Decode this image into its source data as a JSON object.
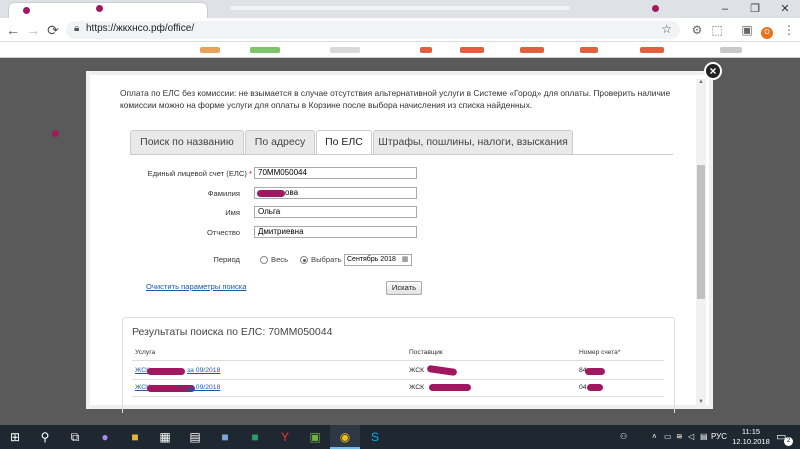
{
  "browser": {
    "url": "https://жкхнсо.рф/office/",
    "buttons": {
      "back": "←",
      "forward": "→",
      "reload": "⟳"
    },
    "window_controls": {
      "minimize": "–",
      "maximize": "❐",
      "close": "✕"
    },
    "profile_initial": "О"
  },
  "modal": {
    "close_label": "×",
    "notice": "Оплата по ЕЛС без комиссии: не взымается в случае отсутствия альтернативной услуги в Системе «Город» для оплаты. Проверить наличие комиссии можно на форме услуги для оплаты в Корзине после выбора начисления из списка найденных.",
    "tabs": [
      {
        "label": "Поиск по названию",
        "active": false
      },
      {
        "label": "По адресу",
        "active": false
      },
      {
        "label": "По ЕЛС",
        "active": true
      },
      {
        "label": "Штрафы, пошлины, налоги, взыскания",
        "active": false
      }
    ],
    "form": {
      "els": {
        "label": "Единый лицевой счет (ЕЛС)",
        "required_mark": "*",
        "value": "70ММ050044"
      },
      "surname": {
        "label": "Фамилия",
        "value": "ова"
      },
      "name": {
        "label": "Имя",
        "value": "Ольга"
      },
      "patronymic": {
        "label": "Отчество",
        "value": "Дмитриевна"
      },
      "period": {
        "label": "Период",
        "options": [
          {
            "label": "Весь",
            "checked": false
          },
          {
            "label": "Выбрать",
            "checked": true
          }
        ],
        "selected_month": "Сентябрь 2018"
      },
      "clear_link": "Очистить параметры поиска",
      "search_button": "Искать"
    },
    "results": {
      "title": "Результаты поиска по ЕЛС: 70ММ050044",
      "columns": [
        "Услуга",
        "Поставщик",
        "Номер счета"
      ],
      "column_marks": [
        "",
        "",
        "*"
      ],
      "rows": [
        {
          "service": "за 09/2018",
          "service_prefix": "ЖСК",
          "supplier": "ЖСК",
          "account": "84"
        },
        {
          "service": "за 09/2018",
          "service_prefix": "ЖСК",
          "supplier": "ЖСК",
          "account": "04"
        }
      ]
    }
  },
  "taskbar": {
    "language": "РУС",
    "time": "11:15",
    "date": "12.10.2018",
    "notifications": "2",
    "icons": [
      "windows-icon",
      "search-icon",
      "task-view-icon",
      "cortana-mic-icon",
      "app-icon",
      "calculator-icon",
      "notepad-icon",
      "excel-icon",
      "yandex-icon",
      "store-icon",
      "chrome-icon",
      "skype-icon"
    ]
  },
  "colors": {
    "redaction": "#a0185f",
    "link": "#1c57a6",
    "taskbar": "#1f2730"
  }
}
